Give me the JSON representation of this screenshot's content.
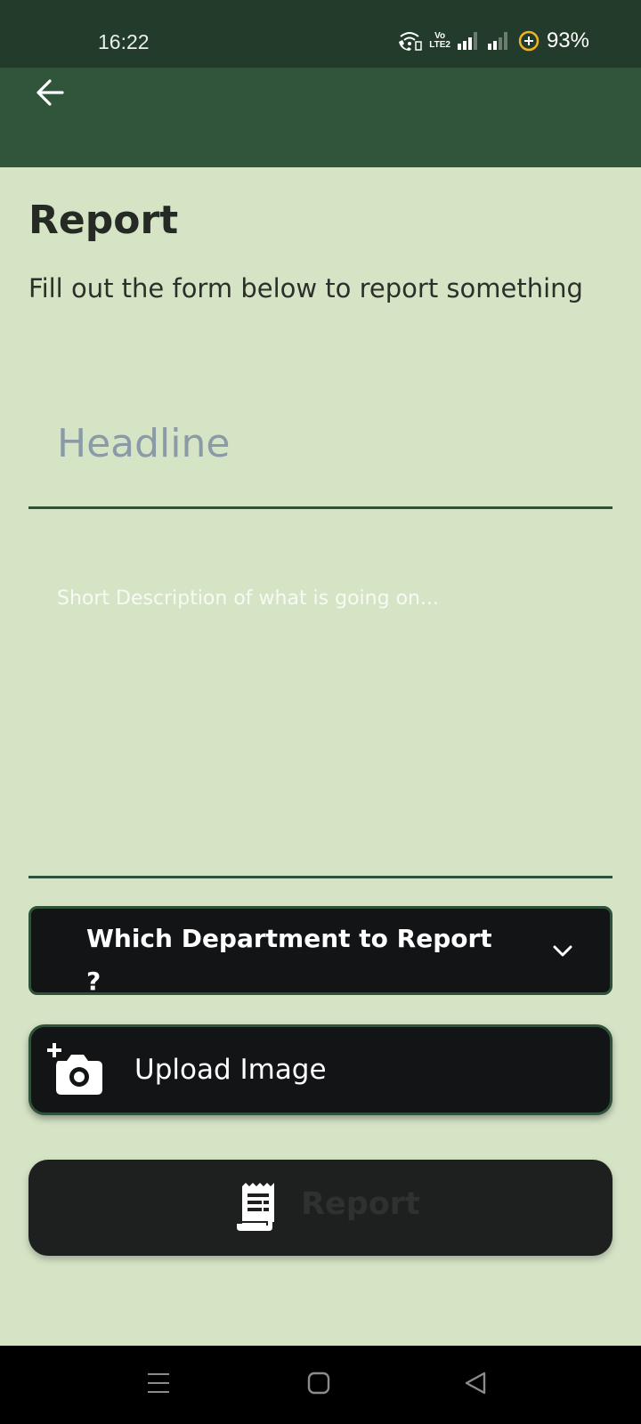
{
  "status_bar": {
    "time": "16:22",
    "volte_top": "Vo",
    "volte_bottom": "LTE2",
    "battery": "93%",
    "icons": [
      "wifi-calling-icon",
      "volte-icon",
      "signal-icon",
      "signal-icon",
      "battery-saver-icon"
    ]
  },
  "app_bar": {
    "back_icon": "arrow-left-icon",
    "color": "#31553a"
  },
  "page": {
    "title": "Report",
    "subtitle": "Fill out the form below to report something"
  },
  "form": {
    "headline_placeholder": "Headline",
    "headline_value": "",
    "description_placeholder": "Short Description of what is going on...",
    "description_value": "",
    "department_label": "Which Department to Report ?",
    "department_icon": "chevron-down-icon",
    "upload_label": "Upload Image",
    "upload_icon": "add-photo-icon",
    "submit_label": "Report",
    "submit_icon": "receipt-icon"
  },
  "nav_bar": {
    "items": [
      "recents-icon",
      "home-icon",
      "back-icon"
    ]
  },
  "colors": {
    "background": "#d6e4c6",
    "status_bar": "#223b2a",
    "accent": "#2e5338",
    "button_dark": "#121416"
  }
}
